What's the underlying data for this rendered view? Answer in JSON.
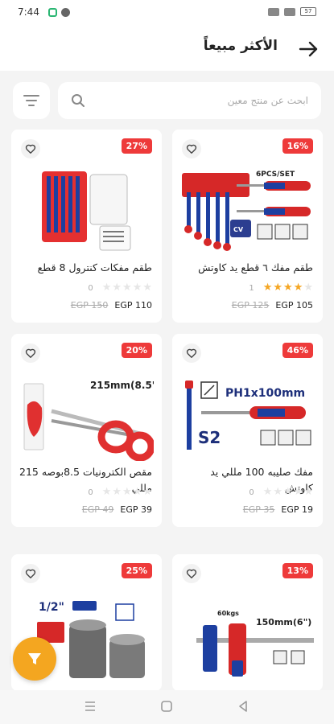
{
  "status": {
    "time": "7:44",
    "battery": "57"
  },
  "header": {
    "title": "الأكثر مبيعاً"
  },
  "search": {
    "placeholder": "ابحث عن منتج معين"
  },
  "products": [
    {
      "name": "طقم مفك ٦ قطع يد كاوتش",
      "discount": "16%",
      "stars": 4,
      "rating_count": "1",
      "old_price": "EGP 125",
      "new_price": "EGP 105",
      "image": "screwdriver-set"
    },
    {
      "name": "طقم مفكات كنترول 8 قطع",
      "discount": "27%",
      "stars": 0,
      "rating_count": "0",
      "old_price": "EGP 150",
      "new_price": "EGP 110",
      "image": "precision-screwdriver-kit"
    },
    {
      "name": "مفك صليبه 100 مللي يد كاوتش",
      "discount": "46%",
      "stars": 0,
      "rating_count": "0",
      "old_price": "EGP 35",
      "new_price": "EGP 19",
      "image": "phillips-screwdriver"
    },
    {
      "name": "مقص الكترونيات 8.5بوصه 215 مللي",
      "discount": "20%",
      "stars": 0,
      "rating_count": "0",
      "old_price": "EGP 49",
      "new_price": "EGP 39",
      "image": "scissors"
    },
    {
      "name": "",
      "discount": "13%",
      "stars": 0,
      "rating_count": "",
      "old_price": "",
      "new_price": "",
      "image": "bar-clamp"
    },
    {
      "name": "",
      "discount": "25%",
      "stars": 0,
      "rating_count": "",
      "old_price": "",
      "new_price": "",
      "image": "socket-set"
    }
  ],
  "image_labels": {
    "screwdriver_set": "6PCS/SET",
    "phillips": "PH1x100mm",
    "phillips_code": "S2",
    "scissors": "215mm(8.5\")",
    "clamp": "150mm(6\")",
    "clamp_load": "60kgs",
    "socket": "1/2\""
  },
  "colors": {
    "accent": "#f4a620",
    "badge": "#ee3a3a",
    "star": "#f5a623"
  }
}
